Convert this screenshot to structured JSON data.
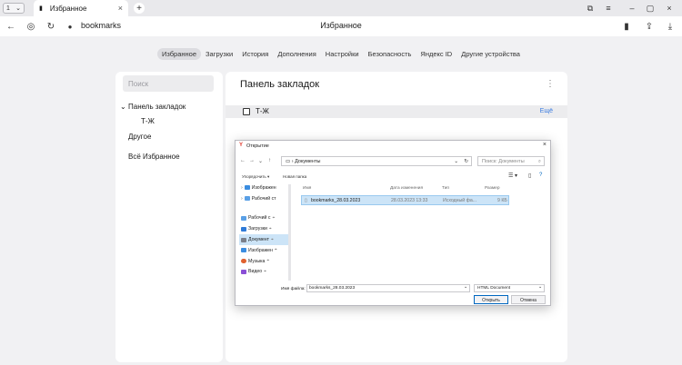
{
  "browser": {
    "tab_counter": "1",
    "tab_title": "Избранное",
    "url": "bookmarks",
    "page_title": "Избранное"
  },
  "settings_nav": {
    "items": [
      "Избранное",
      "Загрузки",
      "История",
      "Дополнения",
      "Настройки",
      "Безопасность",
      "Яндекс ID",
      "Другие устройства"
    ],
    "active_index": 0
  },
  "sidebar": {
    "search_placeholder": "Поиск",
    "panel_label": "Панель закладок",
    "folder": "Т-Ж",
    "other": "Другое",
    "all": "Всё Избранное"
  },
  "main": {
    "title": "Панель закладок",
    "row_label": "Т-Ж",
    "edit_label": "Ещё"
  },
  "dialog": {
    "title": "Открытие",
    "path": "Документы",
    "search_placeholder": "Поиск: Документы",
    "organize_label": "Упорядочить ▾",
    "new_folder_label": "Новая папка",
    "tree": [
      {
        "label": "Изображен",
        "color": "#3b8de0",
        "expand": true
      },
      {
        "label": "Рабочий ст",
        "color": "#5aa0e6",
        "expand": true
      },
      {
        "label": "Рабочий с",
        "color": "#5aa0e6",
        "pin": true
      },
      {
        "label": "Загрузки",
        "color": "#2f7bd8",
        "pin": true
      },
      {
        "label": "Документ",
        "color": "#7a7f8a",
        "pin": true
      },
      {
        "label": "Изображен",
        "color": "#3b8de0",
        "pin": true
      },
      {
        "label": "Музыка",
        "color": "#e0612f",
        "pin": true
      },
      {
        "label": "Видео",
        "color": "#8a4fd6",
        "pin": true
      }
    ],
    "columns": [
      "Имя",
      "Дата изменения",
      "Тип",
      "Размер"
    ],
    "file": {
      "name": "bookmarks_28.03.2023",
      "date": "28.03.2023 13:33",
      "type": "Исходный фа...",
      "size": "9 КБ"
    },
    "filename_label": "Имя файла:",
    "filename_value": "bookmarks_28.03.2023",
    "filetype_value": "HTML Document",
    "open_label": "Открыть",
    "cancel_label": "Отмена"
  },
  "colors": {
    "accent": "#3d7de0",
    "selection": "#cce4f7"
  }
}
